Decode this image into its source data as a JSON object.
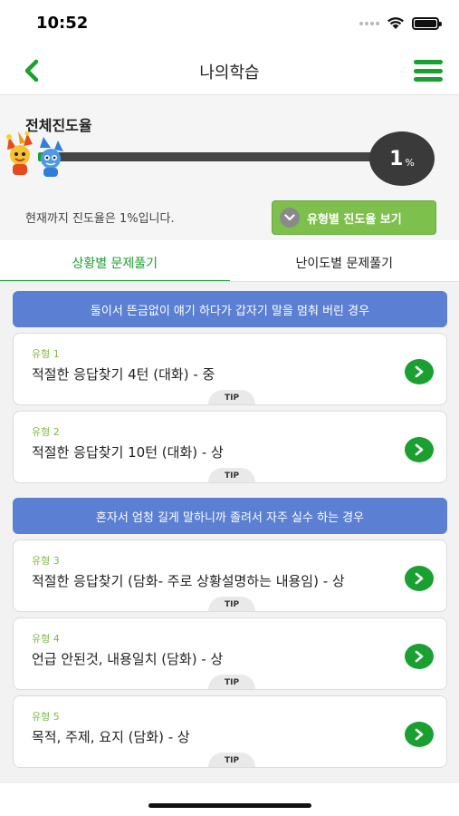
{
  "status_bar": {
    "time": "10:52"
  },
  "header": {
    "title": "나의학습"
  },
  "progress": {
    "section_title": "전체진도율",
    "percent_value": "1",
    "percent_unit": "%",
    "percent_fraction": 0.01,
    "description": "현재까지 진도율은 1%입니다.",
    "type_button_label": "유형별 진도율 보기"
  },
  "tabs": [
    {
      "label": "상황별 문제풀기",
      "active": true
    },
    {
      "label": "난이도별 문제풀기",
      "active": false
    }
  ],
  "situations": [
    {
      "header": "둘이서 뜬금없이 얘기 하다가 갑자기 말을 멈춰 버린 경우"
    },
    {
      "header": "혼자서 엄청 길게 말하니까 졸려서 자주 실수 하는 경우"
    }
  ],
  "cards": [
    {
      "type": "유형 1",
      "title": "적절한 응답찾기 4턴 (대화) - 중",
      "tip": "TIP"
    },
    {
      "type": "유형 2",
      "title": "적절한 응답찾기 10턴 (대화) - 상",
      "tip": "TIP"
    },
    {
      "type": "유형 3",
      "title": "적절한 응답찾기 (담화- 주로 상황설명하는 내용임) - 상",
      "tip": "TIP"
    },
    {
      "type": "유형 4",
      "title": "언급 안된것, 내용일치 (담화) - 상",
      "tip": "TIP"
    },
    {
      "type": "유형 5",
      "title": "목적, 주제, 요지 (담화) - 상",
      "tip": "TIP"
    }
  ],
  "colors": {
    "accent": "#1aa030",
    "header_blue": "#5a7fd3",
    "button_green": "#7dc04b"
  },
  "icons": [
    "back-arrow-icon",
    "hamburger-menu-icon",
    "chevron-down-icon",
    "chevron-right-icon",
    "wifi-icon",
    "battery-icon",
    "signal-icon",
    "mascot-icon"
  ]
}
